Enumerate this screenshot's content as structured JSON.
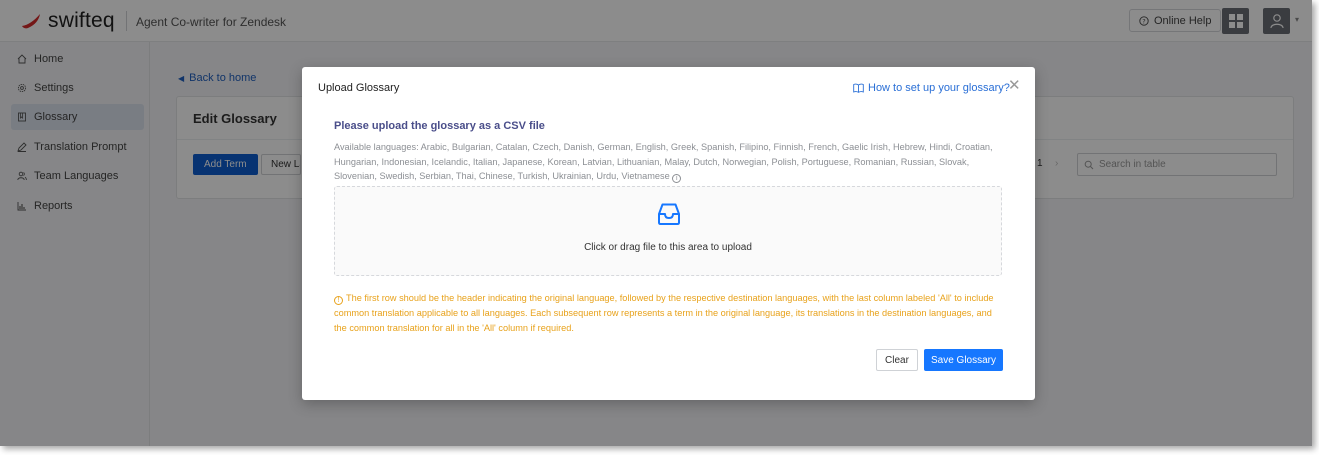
{
  "header": {
    "brand": "swifteq",
    "subtitle": "Agent Co-writer for Zendesk",
    "online_help": "Online Help",
    "brand_color": "#d42a2a"
  },
  "sidebar": {
    "items": [
      {
        "label": "Home",
        "icon": "home-icon"
      },
      {
        "label": "Settings",
        "icon": "gear-icon"
      },
      {
        "label": "Glossary",
        "icon": "book-icon",
        "active": true
      },
      {
        "label": "Translation Prompt",
        "icon": "pen-icon"
      },
      {
        "label": "Team Languages",
        "icon": "users-icon"
      },
      {
        "label": "Reports",
        "icon": "bar-chart-icon"
      }
    ]
  },
  "main": {
    "back_link": "Back to home",
    "title": "Edit Glossary",
    "add_term": "Add Term",
    "new_language": "New La",
    "page_number": "1",
    "search_placeholder": "Search in table"
  },
  "modal": {
    "title": "Upload Glossary",
    "help_link": "How to set up your glossary?",
    "heading": "Please upload the glossary as a CSV file",
    "languages": "Available languages: Arabic, Bulgarian, Catalan, Czech, Danish, German, English, Greek, Spanish, Filipino, Finnish, French, Gaelic Irish, Hebrew, Hindi, Croatian, Hungarian, Indonesian, Icelandic, Italian, Japanese, Korean, Latvian, Lithuanian, Malay, Dutch, Norwegian, Polish, Portuguese, Romanian, Russian, Slovak, Slovenian, Swedish, Serbian, Thai, Chinese, Turkish, Ukrainian, Urdu, Vietnamese",
    "dropzone_text": "Click or drag file to this area to upload",
    "warning": "The first row should be the header indicating the original language, followed by the respective destination languages, with the last column labeled 'All' to include common translation applicable to all languages. Each subsequent row represents a term in the original language, its translations in the destination languages, and the common translation for all in the 'All' column if required.",
    "clear": "Clear",
    "save": "Save Glossary",
    "primary_color": "#1677ff",
    "warning_color": "#e8a21b"
  }
}
